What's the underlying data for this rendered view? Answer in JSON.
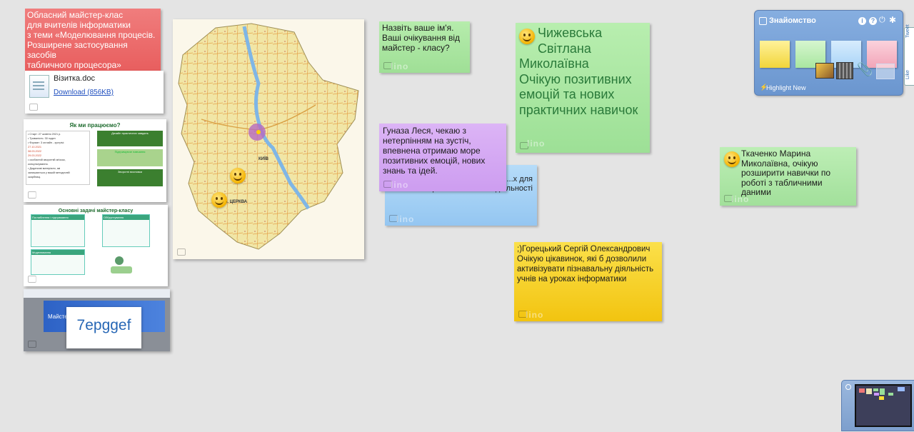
{
  "board": {
    "title_note": "Обласний майстер-клас\n для вчителів інформатики\nз теми «Моделювання процесів.\nРозширене застосування засобів\nтабличного процесора»"
  },
  "file_card": {
    "filename": "Візитка.doc",
    "download_label": "Download (856KB)"
  },
  "slide1": {
    "title": "Як ми працюємо?",
    "lines": [
      "• Старт:        27 жовтня 2021 р.",
      "• Тривалість: 30 годин",
      "• Формат:      3 онлайн - зустрічі:",
      "                  27.10.2021",
      "                  08.03.2022",
      "                  29.03.2022",
      "• особистий зворотній зв'язок,",
      "  консультування.",
      "• Додаткові матеріали, які",
      "  залишаються у вашій методичній",
      "  скарбниці."
    ],
    "box1_title": "Дизайн практичних завдань",
    "box2_title": "Підтримуюче навчання",
    "box3_title": "Зворотні висновки"
  },
  "slide2": {
    "title": "Основні задачі майстер-класу",
    "box1": "Поглиблення і підтримання",
    "box2": "Обґрунтування",
    "box3": "Моделювання"
  },
  "screenshot_card": {
    "code": "7epggef",
    "banner": "Майстер-кл..."
  },
  "notes": {
    "name_prompt": "Назвіть ваше ім'я.\nВаші очікування від\nмайстер - класу?",
    "chyzhevska": "Чижевська\nСвітлана\nМиколаївна\nОчікую позитивних\nемоцій та нових\nпрактичних навичок",
    "gunaza": "Гуназа Леся, чекаю з\nнетерпінням на зустіч,\nвпевнена отримаю море\nпозитивних емоцій, нових\nзнань та ідей.",
    "blue_behind": "...х для\nвикористання в своїй діяльності",
    "horetskyi": ";)Горецький Сергій Олександрович\nОчікую цікавинок, які б дозволили\nактивізувати пізнавальну діяльність\nучнів на уроках інформатики",
    "tkachenko": "Ткаченко Марина\nМиколаївна, очікую\nрозширити навички по\nроботі з табличними даними"
  },
  "map": {
    "city_label": "КИЇВ",
    "label2": "Б. ЦЕРКВА"
  },
  "panel": {
    "title": "Знайомство",
    "highlight_label": "Highlight New",
    "side_tabs": [
      "Tweet",
      "Like"
    ]
  },
  "watermark": "lino",
  "colors": {
    "red_note": "#ee6a6a",
    "green_note": "#a9e6a0",
    "purple_note": "#d6aaf2",
    "blue_note": "#a9d4f7",
    "yellow_note": "#f5cf22",
    "panel": "#7da6d8"
  }
}
